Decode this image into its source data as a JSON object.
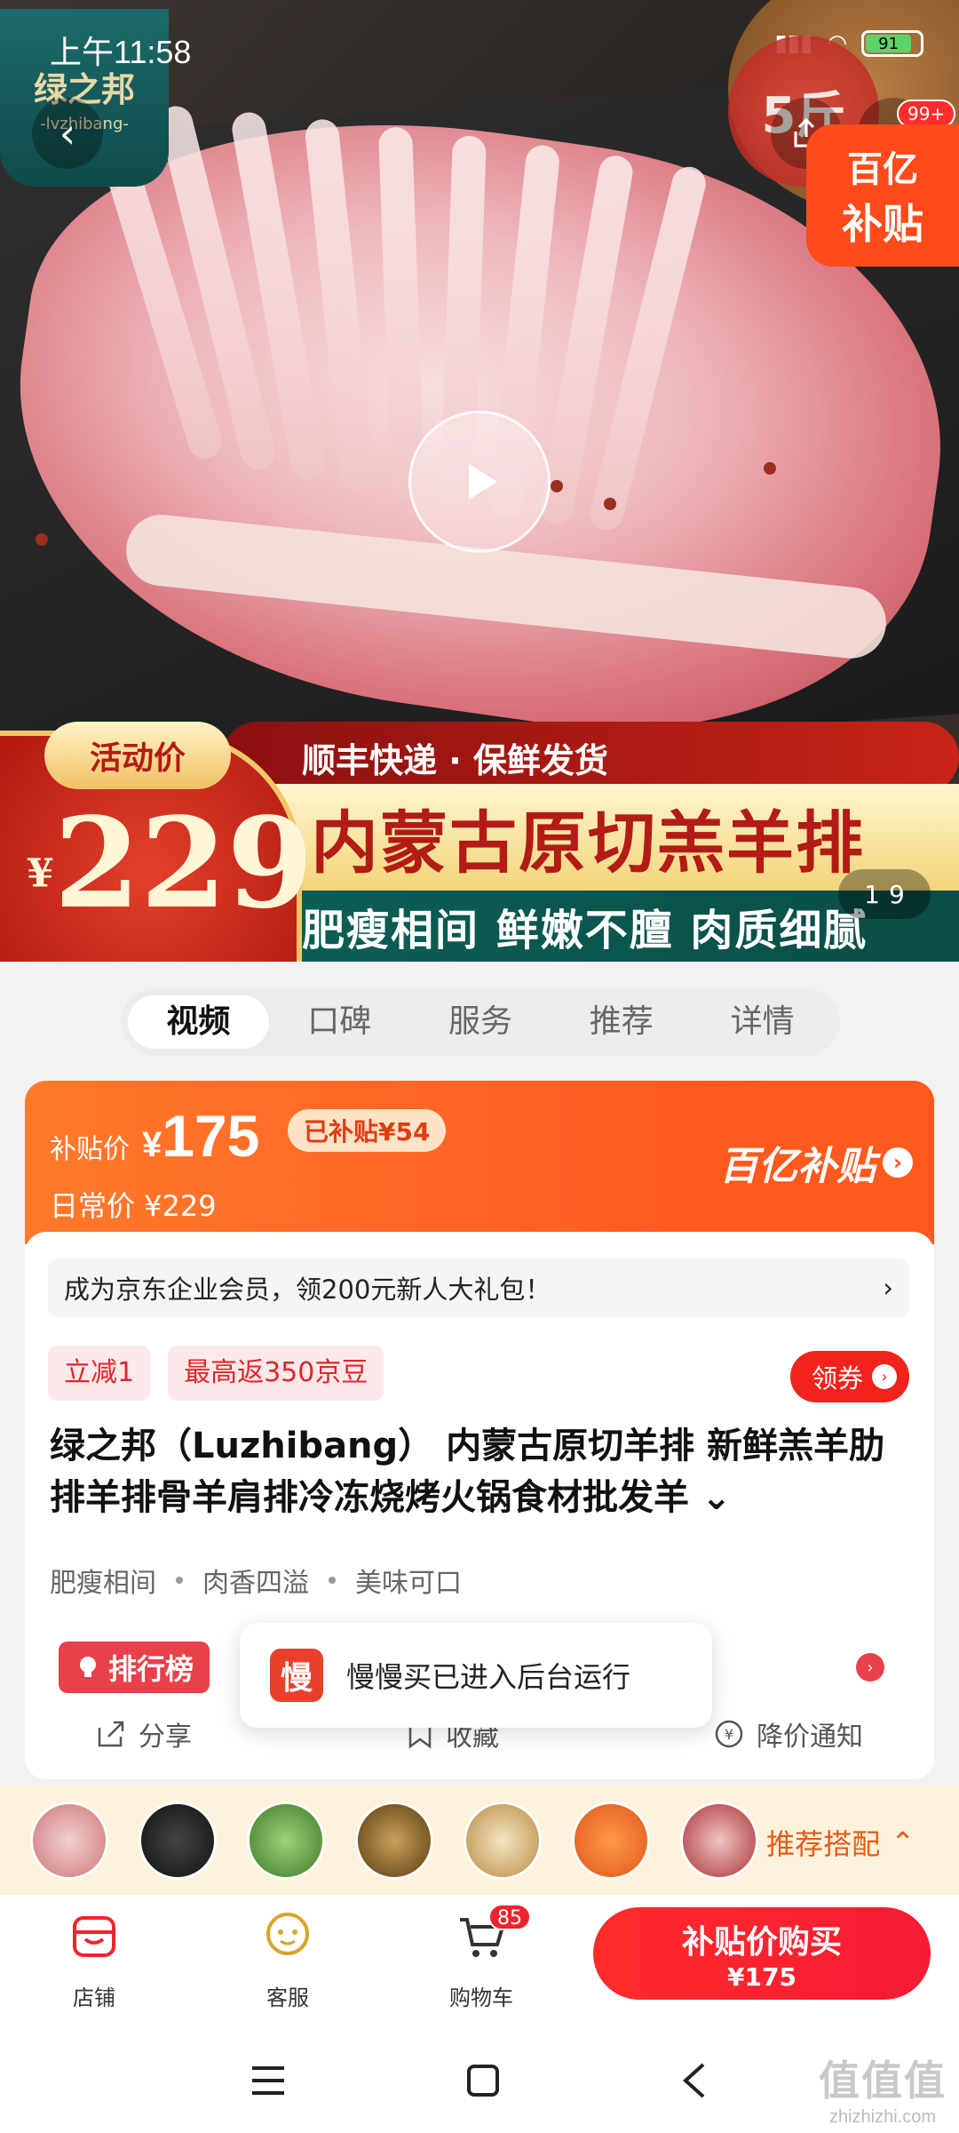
{
  "status_bar": {
    "time": "上午11:58",
    "battery": "91"
  },
  "hero": {
    "brand_name": "绿之邦",
    "brand_sub": "-lvzhibang-",
    "weight_tag": "5斤",
    "more_badge": "99+",
    "yi_badge_line1": "百亿",
    "yi_badge_line2": "补贴",
    "promo_label": "活动价",
    "promo_price_currency": "¥",
    "promo_price": "229",
    "promo_shipping": "顺丰快递 · 保鲜发货",
    "promo_title": "内蒙古原切羔羊排",
    "promo_features": "肥瘦相间 鲜嫩不膻 肉质细腻",
    "page_current": "1",
    "page_total": "9"
  },
  "tabs": [
    "视频",
    "口碑",
    "服务",
    "推荐",
    "详情"
  ],
  "price_card": {
    "subsidy_label": "补贴价",
    "currency": "¥",
    "subsidy_price": "175",
    "saved_tag": "已补贴¥54",
    "daily_price": "日常价 ¥229",
    "yi_logo": "百亿补贴"
  },
  "member_bar": {
    "text": "成为京东企业会员，领200元新人大礼包！",
    "arrow": "›"
  },
  "tags": [
    "立减1",
    "最高返350京豆"
  ],
  "coupon_button": "领券",
  "product_title": "绿之邦（Luzhibang） 内蒙古原切羊排 新鲜羔羊肋排羊排骨羊肩排冷冻烧烤火锅食材批发羊",
  "features": [
    "肥瘦相间",
    "肉香四溢",
    "美味可口"
  ],
  "rank_badge": "排行榜",
  "actions": {
    "share": "分享",
    "collect": "收藏",
    "price_alert": "降价通知"
  },
  "toast": {
    "icon_text": "慢",
    "text": "慢慢买已进入后台运行"
  },
  "recommend": {
    "label": "推荐搭配"
  },
  "bottom_bar": {
    "shop": "店铺",
    "service": "客服",
    "cart": "购物车",
    "cart_count": "85",
    "buy_line1": "补贴价购买",
    "buy_line2": "¥175"
  },
  "watermark": {
    "big": "值值值",
    "small": "zhizhizhi.com"
  },
  "colors": {
    "accent": "#ff4d1e",
    "red": "#f51b34",
    "gold": "#f0c76a",
    "teal": "#0f4a4a"
  }
}
